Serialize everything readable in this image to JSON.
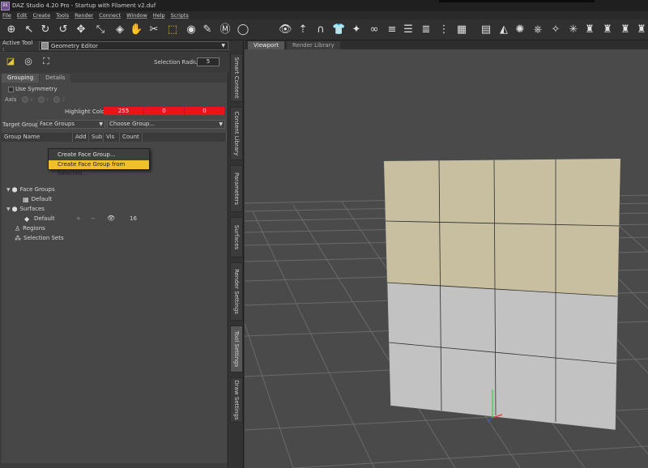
{
  "window": {
    "title": "DAZ Studio 4.20 Pro - Startup with Filament v2.duf",
    "app_badge": "DS"
  },
  "menu": [
    "File",
    "Edit",
    "Create",
    "Tools",
    "Render",
    "Connect",
    "Window",
    "Help",
    "Scripts"
  ],
  "active_tool": {
    "label": "Active Tool :",
    "value": "Geometry Editor"
  },
  "selection_radius": {
    "label": "Selection Radius",
    "value": "5"
  },
  "tabs": {
    "grouping": "Grouping",
    "details": "Details"
  },
  "symmetry": {
    "label": "Use Symmetry",
    "axis_label": "Axis",
    "axes": [
      "X",
      "Y",
      "Z"
    ]
  },
  "highlight": {
    "label": "Highlight Color :",
    "r": "255",
    "g": "0",
    "b": "0",
    "color": "#e8141a"
  },
  "target_group": {
    "label": "Target Group :",
    "value": "Face Groups",
    "choose": "Choose Group..."
  },
  "columns": {
    "group_name": "Group Name",
    "add": "Add",
    "sub": "Sub",
    "vis": "Vis",
    "count": "Count"
  },
  "tree": {
    "face_groups": "Face Groups",
    "face_default": "Default",
    "surfaces": "Surfaces",
    "surface_default": "Default",
    "surface_add": "+",
    "surface_sub": "−",
    "surface_count": "16",
    "regions": "Regions",
    "selection_sets": "Selection Sets"
  },
  "context_menu": {
    "item1": "Create Face Group...",
    "item2": "Create Face Group from Selected..."
  },
  "side_tabs": [
    "Smart Content",
    "Content Library",
    "Parameters",
    "Surfaces",
    "Render Settings",
    "Tool Settings",
    "Draw Settings"
  ],
  "viewport_tabs": {
    "viewport": "Viewport",
    "render_library": "Render Library"
  }
}
